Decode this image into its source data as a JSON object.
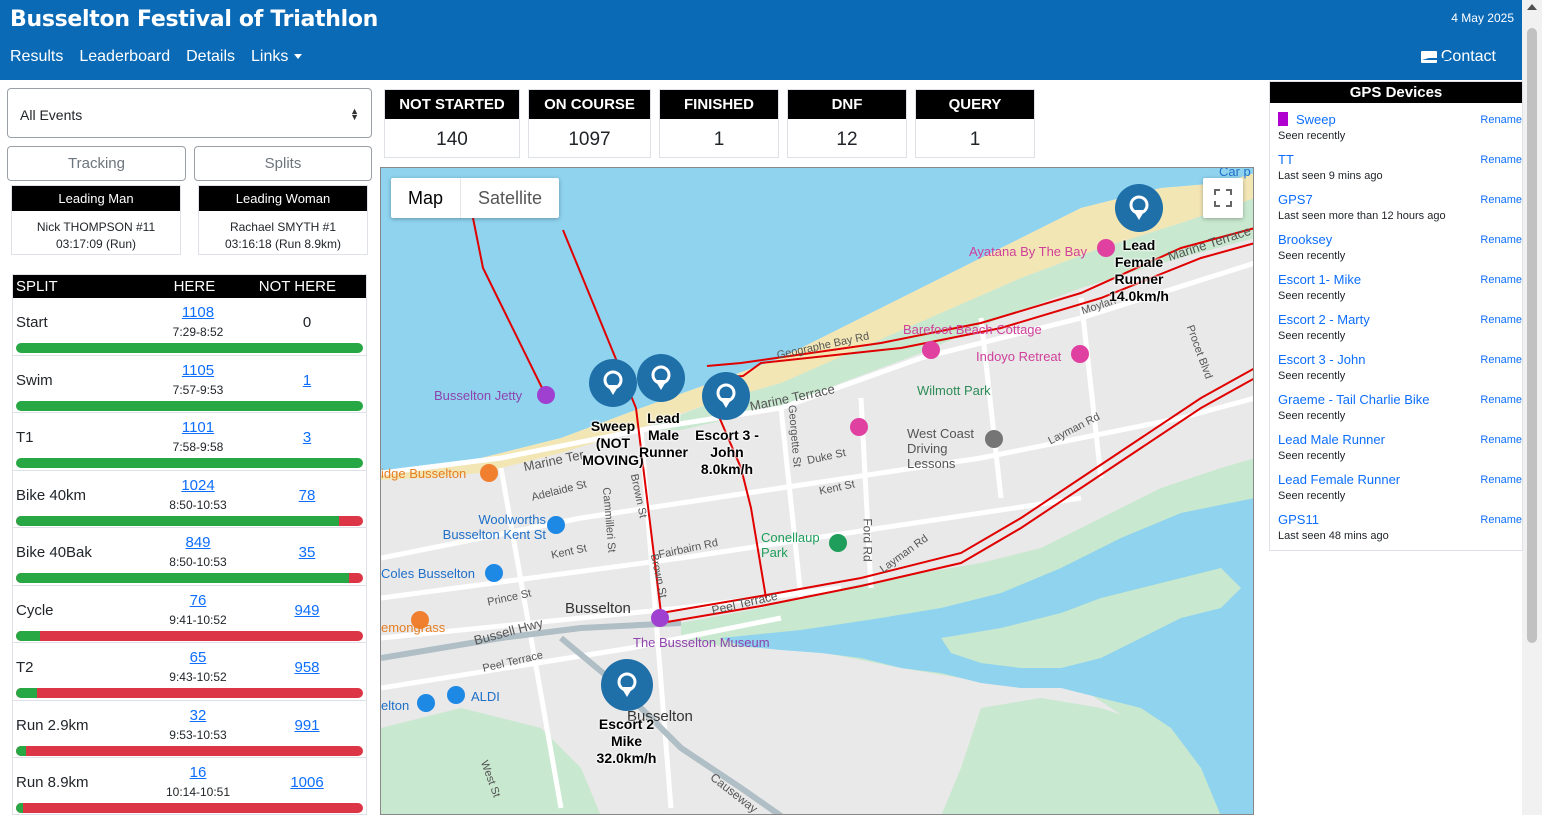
{
  "header": {
    "title": "Busselton Festival of Triathlon",
    "date": "4 May 2025",
    "nav": [
      "Results",
      "Leaderboard",
      "Details",
      "Links"
    ],
    "contact": "Contact"
  },
  "event_select": {
    "value": "All Events"
  },
  "tabs": {
    "tracking": "Tracking",
    "splits": "Splits"
  },
  "leaders": {
    "man": {
      "title": "Leading Man",
      "name": "Nick THOMPSON #11",
      "time": "03:17:09 (Run)"
    },
    "woman": {
      "title": "Leading Woman",
      "name": "Rachael SMYTH #1",
      "time": "03:16:18 (Run 8.9km)"
    }
  },
  "stats": [
    {
      "label": "NOT STARTED",
      "value": "140"
    },
    {
      "label": "ON COURSE",
      "value": "1097"
    },
    {
      "label": "FINISHED",
      "value": "1"
    },
    {
      "label": "DNF",
      "value": "12"
    },
    {
      "label": "QUERY",
      "value": "1"
    }
  ],
  "splits": {
    "headers": {
      "split": "SPLIT",
      "here": "HERE",
      "not_here": "NOT HERE"
    },
    "rows": [
      {
        "name": "Start",
        "here": "1108",
        "time": "7:29-8:52",
        "not_here": "0",
        "not_here_link": false,
        "progress": 1.0
      },
      {
        "name": "Swim",
        "here": "1105",
        "time": "7:57-9:53",
        "not_here": "1",
        "not_here_link": true,
        "progress": 1.0
      },
      {
        "name": "T1",
        "here": "1101",
        "time": "7:58-9:58",
        "not_here": "3",
        "not_here_link": true,
        "progress": 1.0
      },
      {
        "name": "Bike 40km",
        "here": "1024",
        "time": "8:50-10:53",
        "not_here": "78",
        "not_here_link": true,
        "progress": 0.93
      },
      {
        "name": "Bike 40Bak",
        "here": "849",
        "time": "8:50-10:53",
        "not_here": "35",
        "not_here_link": true,
        "progress": 0.96
      },
      {
        "name": "Cycle",
        "here": "76",
        "time": "9:41-10:52",
        "not_here": "949",
        "not_here_link": true,
        "progress": 0.07
      },
      {
        "name": "T2",
        "here": "65",
        "time": "9:43-10:52",
        "not_here": "958",
        "not_here_link": true,
        "progress": 0.06
      },
      {
        "name": "Run 2.9km",
        "here": "32",
        "time": "9:53-10:53",
        "not_here": "991",
        "not_here_link": true,
        "progress": 0.03
      },
      {
        "name": "Run 8.9km",
        "here": "16",
        "time": "10:14-10:51",
        "not_here": "1006",
        "not_here_link": true,
        "progress": 0.02
      }
    ]
  },
  "map": {
    "map_button": "Map",
    "satellite_button": "Satellite",
    "places": {
      "ayatana": "Ayatana By The Bay",
      "barefoot": "Barefoot Beach Cottage",
      "indoyo": "Indoyo Retreat",
      "wilmott": "Wilmott Park",
      "westcoast": "West Coast Driving Lessons",
      "jetty": "Busselton Jetty",
      "woolworths": "Woolworths Busselton Kent St",
      "coles": "Coles Busselton",
      "conelaup": "Conellaup Park",
      "museum": "The Busselton Museum",
      "busselton": "Busselton",
      "aldi": "ALDI",
      "lemongrass": "emongrass",
      "idge": "idge Busselton",
      "carpark": "Car p",
      "elton": "elton"
    },
    "streets": {
      "marine_terrace": "Marine Terrace",
      "geographe": "Geographe Bay Rd",
      "layman": "Layman Rd",
      "peel": "Peel Terrace",
      "kent": "Kent St",
      "duke": "Duke St",
      "fairbairn": "Fairbairn Rd",
      "prince": "Prince St",
      "bussell": "Bussell Hwy",
      "adelaide": "Adelaide St",
      "brown": "Brown St",
      "ford": "Ford Rd",
      "causeway": "Causeway",
      "georgette": "Georgette St",
      "camilleri": "Cammilleri St",
      "moylan": "Moylan",
      "procet": "Procet Blvd",
      "west": "West St",
      "marine_ter_short": "Marine Ter"
    },
    "markers": [
      {
        "label": "Lead Female Runner 14.0km/h"
      },
      {
        "label": "Sweep (NOT MOVING)"
      },
      {
        "label": "Lead Male Runner"
      },
      {
        "label": "Escort 3 - John 8.0km/h"
      },
      {
        "label": "Escort 2 Mike 32.0km/h"
      }
    ]
  },
  "gps": {
    "title": "GPS Devices",
    "rename_label": "Rename",
    "devices": [
      {
        "name": "Sweep",
        "seen": "Seen recently",
        "swatch": "#b000d0"
      },
      {
        "name": "TT",
        "seen": "Last seen 9 mins ago"
      },
      {
        "name": "GPS7",
        "seen": "Last seen more than 12 hours ago"
      },
      {
        "name": "Brooksey",
        "seen": "Seen recently"
      },
      {
        "name": "Escort 1- Mike",
        "seen": "Seen recently"
      },
      {
        "name": "Escort 2 - Marty",
        "seen": "Seen recently"
      },
      {
        "name": "Escort 3 - John",
        "seen": "Seen recently"
      },
      {
        "name": "Graeme - Tail Charlie Bike",
        "seen": "Seen recently"
      },
      {
        "name": "Lead Male Runner",
        "seen": "Seen recently"
      },
      {
        "name": "Lead Female Runner",
        "seen": "Seen recently"
      },
      {
        "name": "GPS11",
        "seen": "Last seen 48 mins ago"
      }
    ]
  },
  "colors": {
    "header_bg": "#0a6ab6",
    "link": "#0d6efd",
    "progress_done": "#28a745",
    "progress_remaining": "#dc3545",
    "marker": "#1f6fa8",
    "route": "#e00000"
  }
}
